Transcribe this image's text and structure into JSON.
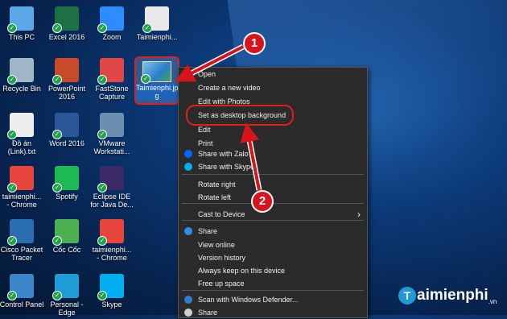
{
  "desktop": {
    "icons": [
      {
        "label": "This PC",
        "color": "#5aa9e6"
      },
      {
        "label": "Excel 2016",
        "color": "#1d7044"
      },
      {
        "label": "Zoom",
        "color": "#2d8cff"
      },
      {
        "label": "Taimienphi...",
        "color": "#e8e8e8"
      },
      {
        "label": "Recycle Bin",
        "color": "#9fb6c9"
      },
      {
        "label": "PowerPoint\n2016",
        "color": "#c94a2b"
      },
      {
        "label": "FastStone\nCapture",
        "color": "#e04848"
      },
      {
        "label": "Đồ án\n(Link).txt",
        "color": "#eeeeee"
      },
      {
        "label": "Word 2016",
        "color": "#2b5798"
      },
      {
        "label": "VMware\nWorkstati...",
        "color": "#6c8fb0"
      },
      {
        "label": "taimienphi...\n- Chrome",
        "color": "#e8453c"
      },
      {
        "label": "Spotify",
        "color": "#1db954"
      },
      {
        "label": "Eclipse IDE\nfor Java De...",
        "color": "#3b2a66"
      },
      {
        "label": "Cisco Packet\nTracer",
        "color": "#2a6db0"
      },
      {
        "label": "Cốc Cốc",
        "color": "#4caf50"
      },
      {
        "label": "taimienphi...\n- Chrome",
        "color": "#e8453c"
      },
      {
        "label": "Control Panel",
        "color": "#3a86c8"
      },
      {
        "label": "Personal -\nEdge",
        "color": "#1f9bd6"
      },
      {
        "label": "Skype",
        "color": "#00aff0"
      }
    ],
    "selected_icon": {
      "label": "Taimienphi.jp\ng"
    }
  },
  "context_menu": {
    "items": [
      {
        "label": "Open"
      },
      {
        "label": "Create a new video"
      },
      {
        "label": "Edit with Photos"
      },
      {
        "label": "Set as desktop background"
      },
      {
        "label": "Edit"
      },
      {
        "label": "Print"
      },
      {
        "label": "Share with Zalo",
        "icon": "zalo-icon"
      },
      {
        "label": "Share with Skype",
        "icon": "skype-icon"
      },
      {
        "label": "Rotate right"
      },
      {
        "label": "Rotate left"
      },
      {
        "label": "Cast to Device",
        "submenu": "›"
      },
      {
        "label": "Share",
        "icon": "onedrive-icon"
      },
      {
        "label": "View online"
      },
      {
        "label": "Version history"
      },
      {
        "label": "Always keep on this device"
      },
      {
        "label": "Free up space"
      },
      {
        "label": "Scan with Windows Defender...",
        "icon": "defender-icon"
      },
      {
        "label": "Share",
        "icon": "share-icon"
      }
    ]
  },
  "annotations": {
    "badge1": "1",
    "badge2": "2",
    "accent": "#d7141b"
  },
  "watermark": {
    "brand": "aimienphi",
    "ball": "T",
    "tld": ".vn"
  }
}
